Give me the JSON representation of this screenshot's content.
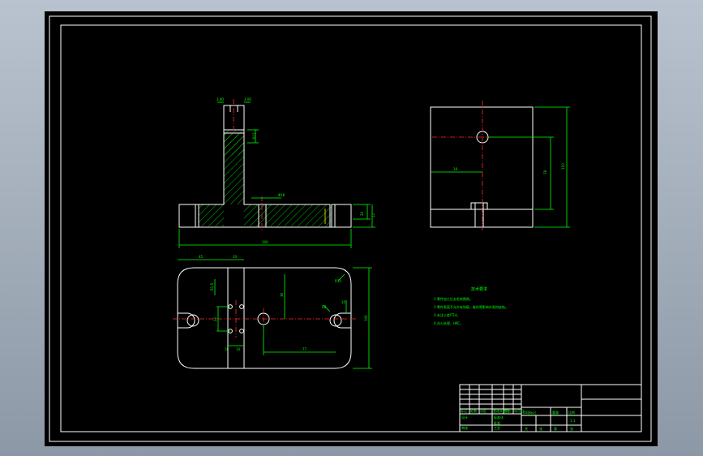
{
  "colors": {
    "background": "#000000",
    "outline": "#ffffff",
    "dimension": "#00ff00",
    "centerline": "#ff2a2a",
    "hatch": "#00ff00",
    "surround": "#a4afbc"
  },
  "dimensions": {
    "front_top_left": "3.00",
    "front_top_right": "3.00",
    "front_slot": "R11",
    "front_bore": "Φ16",
    "front_height_right": "20",
    "front_height_right2": "12",
    "front_width": "100",
    "side_hole_offset": "18",
    "side_height": "78",
    "side_height_total": "110",
    "plan_left": "45",
    "plan_mid": "10",
    "plan_side": "R1.5",
    "plan_hole_pitch": "22",
    "plan_row": "36",
    "plan_holes": "10",
    "plan_holes2": "14",
    "plan_bore_dist": "77",
    "plan_radius": "R10",
    "plan_slot": "R8",
    "plan_slot_width": "10",
    "plan_height": "100"
  },
  "notes": {
    "title": "技术要求",
    "items": [
      "1.零件加工后去毛刺倒角。",
      "2.零件表面不允许有划痕、碰伤等影响外观的缺陷。",
      "3.未注公差IT14。",
      "4.淬火处理，HRC。"
    ]
  },
  "title_block": {
    "labels": [
      "标记",
      "处数",
      "分区",
      "更改文件号",
      "签名",
      "年月日",
      "设计",
      "标准化",
      "审核",
      "工艺",
      "批准",
      "阶段标记",
      "重量",
      "比例",
      "共",
      "张",
      "第",
      "张"
    ],
    "scale": "1:1"
  }
}
